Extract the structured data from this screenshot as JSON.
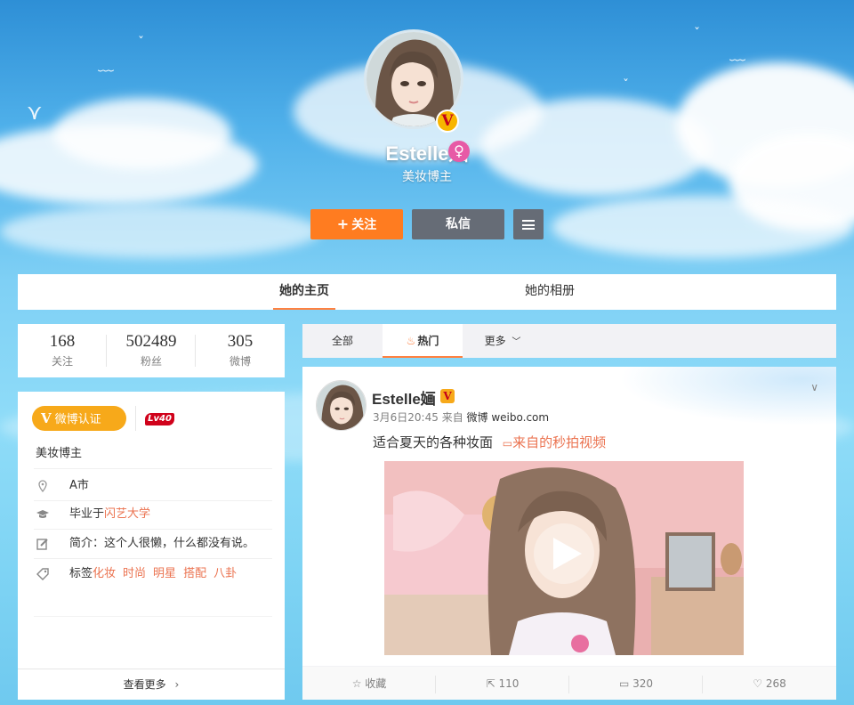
{
  "profile": {
    "name": "Estelle婳",
    "subtitle": "美妆博主",
    "verified_badge": "V",
    "gender_icon": "♀"
  },
  "actions": {
    "follow_label": "关注",
    "message_label": "私信"
  },
  "tabs": [
    {
      "label": "她的主页",
      "active": true
    },
    {
      "label": "她的相册",
      "active": false
    }
  ],
  "stats": [
    {
      "value": "168",
      "label": "关注"
    },
    {
      "value": "502489",
      "label": "粉丝"
    },
    {
      "value": "305",
      "label": "微博"
    }
  ],
  "info": {
    "verify_label": "微博认证",
    "verify_icon": "V",
    "level": "Lv40",
    "description": "美妆博主",
    "location": "A市",
    "education_prefix": "毕业于",
    "education_school": "闪艺大学",
    "bio": "简介：这个人很懒，什么都没有说。",
    "tags_prefix": "标签",
    "tags": [
      "化妆",
      "时尚",
      "明星",
      "搭配",
      "八卦"
    ],
    "more_label": "查看更多"
  },
  "feed_filter": [
    {
      "label": "全部",
      "active": false
    },
    {
      "label": "热门",
      "active": true
    },
    {
      "label": "更多",
      "active": false
    }
  ],
  "post": {
    "author": "Estelle婳",
    "verified_badge": "V",
    "time": "3月6日20:45",
    "source_prefix": "来自",
    "source": "微博 weibo.com",
    "text": "适合夏天的各种妆面",
    "video_link": "来自的秒拍视频",
    "actions": [
      {
        "label": "收藏",
        "icon": "star-icon"
      },
      {
        "label": "110",
        "icon": "share-icon"
      },
      {
        "label": "320",
        "icon": "comment-icon"
      },
      {
        "label": "268",
        "icon": "like-icon"
      }
    ]
  },
  "colors": {
    "accent": "#ff7c20",
    "link": "#eb7350",
    "gold": "#f7a91a",
    "dark_button": "#666c76"
  }
}
